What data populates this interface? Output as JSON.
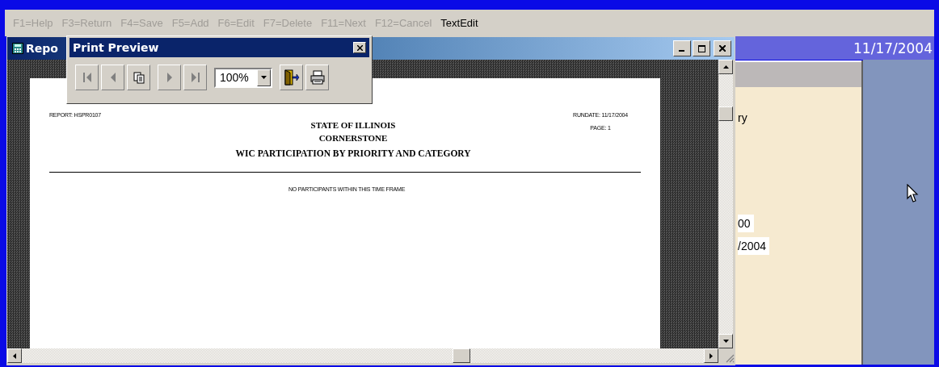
{
  "menu_bar": {
    "items": [
      {
        "label": "F1=Help",
        "disabled": true
      },
      {
        "label": "F3=Return",
        "disabled": true
      },
      {
        "label": "F4=Save",
        "disabled": true
      },
      {
        "label": "F5=Add",
        "disabled": true
      },
      {
        "label": "F6=Edit",
        "disabled": true
      },
      {
        "label": "F7=Delete",
        "disabled": true
      },
      {
        "label": "F11=Next",
        "disabled": true
      },
      {
        "label": "F12=Cancel",
        "disabled": true
      },
      {
        "label": "TextEdit",
        "disabled": false
      }
    ]
  },
  "back_window": {
    "date": "11/17/2004",
    "fragments": [
      {
        "kind": "label",
        "text": "ry"
      },
      {
        "kind": "field",
        "text": "00"
      },
      {
        "kind": "field",
        "text": "/2004"
      }
    ]
  },
  "report_window": {
    "title": "Repo",
    "page": {
      "report_id": "REPORT: HSPR0107",
      "run_date": "RUNDATE: 11/17/2004",
      "page_number": "PAGE: 1",
      "titles": [
        "STATE OF ILLINOIS",
        "CORNERSTONE",
        "WIC PARTICIPATION BY PRIORITY AND CATEGORY"
      ],
      "message": "NO PARTICIPANTS WITHIN THIS TIME FRAME"
    }
  },
  "print_preview": {
    "title": "Print Preview",
    "zoom": "100%",
    "buttons": [
      {
        "kind": "first",
        "disabled": true
      },
      {
        "kind": "previous",
        "disabled": true
      },
      {
        "kind": "pages"
      },
      {
        "kind": "next",
        "disabled": true
      },
      {
        "kind": "last",
        "disabled": true
      },
      {
        "kind": "zoom"
      },
      {
        "kind": "exit"
      },
      {
        "kind": "print"
      }
    ]
  }
}
